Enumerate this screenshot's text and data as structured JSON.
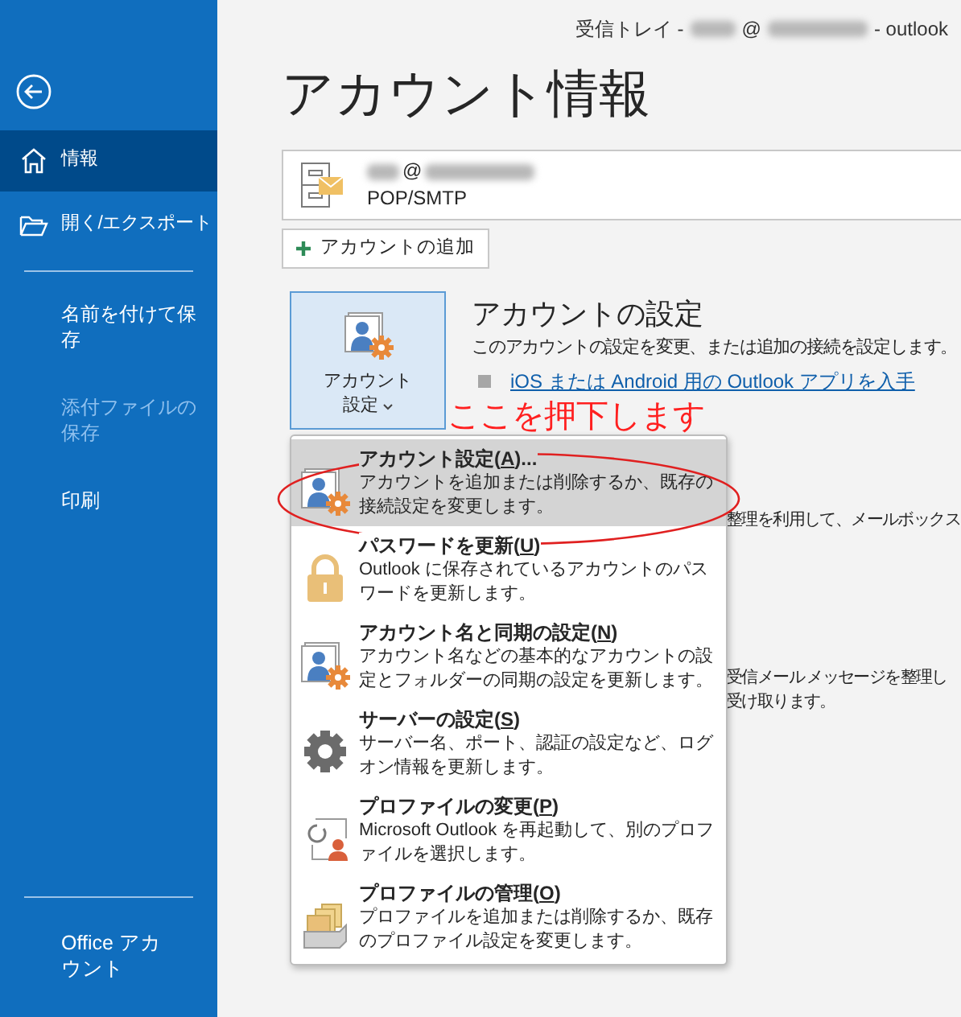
{
  "window": {
    "title_prefix": "受信トレイ -",
    "title_at": "@",
    "title_suffix": "- outlook"
  },
  "sidebar": {
    "nav": [
      {
        "kind": "home",
        "label": "情報",
        "selected": true
      },
      {
        "kind": "folder",
        "label": "開く/エクスポート",
        "selected": false
      }
    ],
    "commands": [
      {
        "label": "名前を付けて保存",
        "disabled": false
      },
      {
        "label": "添付ファイルの保存",
        "disabled": true
      },
      {
        "label": "印刷",
        "disabled": false
      }
    ],
    "footer": "Office アカウント"
  },
  "heading": "アカウント情報",
  "account": {
    "at": "@",
    "type": "POP/SMTP"
  },
  "add_account": "アカウントの追加",
  "account_settings": {
    "button_line1": "アカウント",
    "button_line2": "設定",
    "title": "アカウントの設定",
    "description": "このアカウントの設定を変更、または追加の接続を設定します。",
    "link": "iOS または Android 用の Outlook アプリを入手"
  },
  "annotation": {
    "text": "ここを押下します"
  },
  "menu": [
    {
      "kind": "account",
      "title": "アカウント設定(",
      "mnemonic": "A",
      "title_end": ")...",
      "description": "アカウントを追加または削除するか、既存の接続設定を変更します。",
      "selected": true
    },
    {
      "kind": "lock",
      "title": "パスワードを更新(",
      "mnemonic": "U",
      "title_end": ")",
      "description": "Outlook に保存されているアカウントのパスワードを更新します。",
      "selected": false
    },
    {
      "kind": "account",
      "title": "アカウント名と同期の設定(",
      "mnemonic": "N",
      "title_end": ")",
      "description": "アカウント名などの基本的なアカウントの設定とフォルダーの同期の設定を更新します。",
      "selected": false
    },
    {
      "kind": "gear",
      "title": "サーバーの設定(",
      "mnemonic": "S",
      "title_end": ")",
      "description": "サーバー名、ポート、認証の設定など、ログオン情報を更新します。",
      "selected": false
    },
    {
      "kind": "profile-change",
      "title": "プロファイルの変更(",
      "mnemonic": "P",
      "title_end": ")",
      "description": "Microsoft Outlook を再起動して、別のプロファイルを選択します。",
      "selected": false
    },
    {
      "kind": "profile-manage",
      "title": "プロファイルの管理(",
      "mnemonic": "O",
      "title_end": ")",
      "description": "プロファイルを追加または削除するか、既存のプロファイル設定を変更します。",
      "selected": false
    }
  ],
  "behind_texts": [
    {
      "lines": [
        "整理を利用して、メールボックス"
      ]
    },
    {
      "lines": [
        "受信メール メッセージを整理し",
        "受け取ります。"
      ]
    }
  ]
}
